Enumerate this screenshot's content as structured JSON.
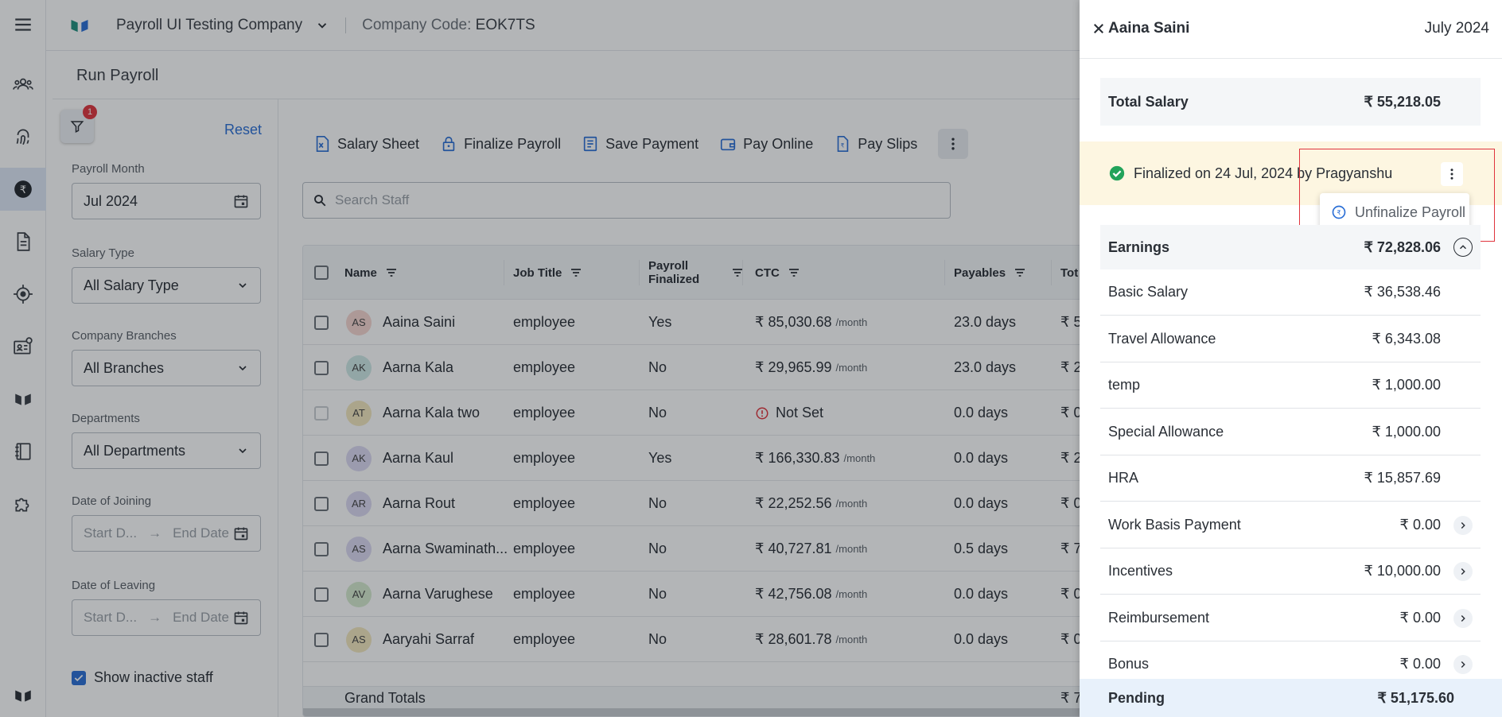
{
  "topbar": {
    "company": "Payroll UI Testing Company",
    "company_code_label": "Company Code:",
    "company_code": "EOK7TS"
  },
  "page_title": "Run Payroll",
  "filters": {
    "badge": "1",
    "reset": "Reset",
    "payroll_month_label": "Payroll Month",
    "payroll_month": "Jul 2024",
    "salary_type_label": "Salary Type",
    "salary_type": "All Salary Type",
    "branches_label": "Company Branches",
    "branches": "All Branches",
    "departments_label": "Departments",
    "departments": "All Departments",
    "doj_label": "Date of Joining",
    "dol_label": "Date of Leaving",
    "start_placeholder": "Start D...",
    "end_placeholder": "End Date",
    "show_inactive": "Show inactive staff"
  },
  "toolbar": {
    "salary_sheet": "Salary Sheet",
    "finalize": "Finalize Payroll",
    "save_payment": "Save Payment",
    "pay_online": "Pay Online",
    "pay_slips": "Pay Slips"
  },
  "search": {
    "placeholder": "Search Staff"
  },
  "table": {
    "headers": {
      "name": "Name",
      "job_title": "Job Title",
      "payroll_line1": "Payroll",
      "payroll_line2": "Finalized",
      "ctc": "CTC",
      "payables": "Payables",
      "total": "Tot"
    },
    "per_month": "/month",
    "rows": [
      {
        "initials": "AS",
        "name": "Aaina Saini",
        "job": "employee",
        "finalized": "Yes",
        "ctc": "₹ 85,030.68",
        "payables": "23.0 days",
        "total": "₹ 5"
      },
      {
        "initials": "AK",
        "name": "Aarna Kala",
        "job": "employee",
        "finalized": "No",
        "ctc": "₹ 29,965.99",
        "payables": "23.0 days",
        "total": "₹ 2"
      },
      {
        "initials": "AT",
        "name": "Aarna Kala two",
        "job": "employee",
        "finalized": "No",
        "ctc": "Not Set",
        "payables": "0.0 days",
        "total": "₹ 0"
      },
      {
        "initials": "AK",
        "name": "Aarna Kaul",
        "job": "employee",
        "finalized": "Yes",
        "ctc": "₹ 166,330.83",
        "payables": "0.0 days",
        "total": "₹ 2"
      },
      {
        "initials": "AR",
        "name": "Aarna Rout",
        "job": "employee",
        "finalized": "No",
        "ctc": "₹ 22,252.56",
        "payables": "0.0 days",
        "total": "₹ 0"
      },
      {
        "initials": "AS",
        "name": "Aarna Swaminath...",
        "job": "employee",
        "finalized": "No",
        "ctc": "₹ 40,727.81",
        "payables": "0.5 days",
        "total": "₹ 7"
      },
      {
        "initials": "AV",
        "name": "Aarna Varughese",
        "job": "employee",
        "finalized": "No",
        "ctc": "₹ 42,756.08",
        "payables": "0.0 days",
        "total": "₹ 0"
      },
      {
        "initials": "AS",
        "name": "Aaryahi Sarraf",
        "job": "employee",
        "finalized": "No",
        "ctc": "₹ 28,601.78",
        "payables": "0.0 days",
        "total": "₹ 0"
      }
    ],
    "grand_totals": "Grand Totals",
    "grand_total_value": "₹ 7"
  },
  "drawer": {
    "name": "Aaina Saini",
    "month": "July 2024",
    "total_label": "Total Salary",
    "total_value": "₹ 55,218.05",
    "finalized_text": "Finalized on 24 Jul, 2024 by Pragyanshu",
    "menu_item": "Unfinalize Payroll",
    "earnings_label": "Earnings",
    "earnings_value": "₹ 72,828.06",
    "earnings": [
      {
        "label": "Basic Salary",
        "value": "₹ 36,538.46"
      },
      {
        "label": "Travel Allowance",
        "value": "₹ 6,343.08"
      },
      {
        "label": "temp",
        "value": "₹ 1,000.00"
      },
      {
        "label": "Special Allowance",
        "value": "₹ 1,000.00"
      },
      {
        "label": "HRA",
        "value": "₹ 15,857.69"
      },
      {
        "label": "Work Basis Payment",
        "value": "₹ 0.00"
      },
      {
        "label": "Incentives",
        "value": "₹ 10,000.00"
      },
      {
        "label": "Reimbursement",
        "value": "₹ 0.00"
      },
      {
        "label": "Bonus",
        "value": "₹ 0.00"
      }
    ],
    "pending_label": "Pending",
    "pending_value": "₹ 51,175.60"
  },
  "colors": {
    "accent": "#2b6fd6",
    "success": "#22a35a",
    "danger": "#e0343d",
    "final_bg": "#fdf6e1"
  }
}
